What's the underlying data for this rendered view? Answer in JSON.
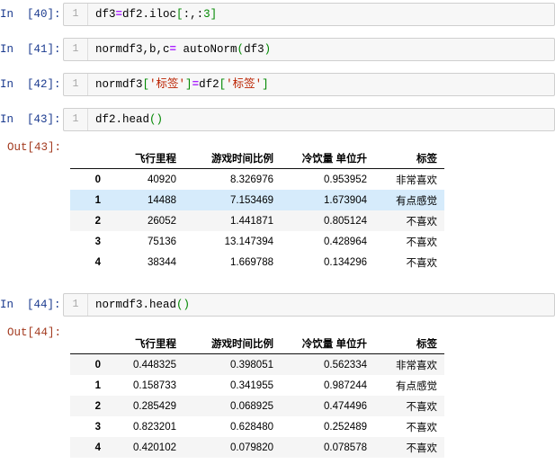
{
  "notebook": {
    "cells": [
      {
        "prompt": "In  [40]:",
        "line_number": "1",
        "code_segments": [
          {
            "text": "df3",
            "kind": "plain"
          },
          {
            "text": "=",
            "kind": "op"
          },
          {
            "text": "df2.iloc",
            "kind": "plain"
          },
          {
            "text": "[",
            "kind": "punct"
          },
          {
            "text": ":,:",
            "kind": "plain"
          },
          {
            "text": "3",
            "kind": "num"
          },
          {
            "text": "]",
            "kind": "punct"
          }
        ]
      },
      {
        "prompt": "In  [41]:",
        "line_number": "1",
        "code_segments": [
          {
            "text": "normdf3,b,c",
            "kind": "plain"
          },
          {
            "text": "=",
            "kind": "op"
          },
          {
            "text": " autoNorm",
            "kind": "plain"
          },
          {
            "text": "(",
            "kind": "punct"
          },
          {
            "text": "df3",
            "kind": "plain"
          },
          {
            "text": ")",
            "kind": "punct"
          }
        ]
      },
      {
        "prompt": "In  [42]:",
        "line_number": "1",
        "code_segments": [
          {
            "text": "normdf3",
            "kind": "plain"
          },
          {
            "text": "[",
            "kind": "punct"
          },
          {
            "text": "'标签'",
            "kind": "str"
          },
          {
            "text": "]",
            "kind": "punct"
          },
          {
            "text": "=",
            "kind": "op"
          },
          {
            "text": "df2",
            "kind": "plain"
          },
          {
            "text": "[",
            "kind": "punct"
          },
          {
            "text": "'标签'",
            "kind": "str"
          },
          {
            "text": "]",
            "kind": "punct"
          }
        ]
      },
      {
        "prompt": "In  [43]:",
        "line_number": "1",
        "code_segments": [
          {
            "text": "df2.head",
            "kind": "plain"
          },
          {
            "text": "()",
            "kind": "punct"
          }
        ]
      },
      {
        "prompt": "In  [44]:",
        "line_number": "1",
        "code_segments": [
          {
            "text": "normdf3.head",
            "kind": "plain"
          },
          {
            "text": "()",
            "kind": "punct"
          }
        ]
      }
    ],
    "outputs": [
      {
        "prompt": "Out[43]:",
        "columns": [
          "",
          "飞行里程",
          "游戏时间比例",
          "冷饮量 单位升",
          "标签"
        ],
        "rows": [
          {
            "index": "0",
            "values": [
              "40920",
              "8.326976",
              "0.953952",
              "非常喜欢"
            ],
            "style": "plain"
          },
          {
            "index": "1",
            "values": [
              "14488",
              "7.153469",
              "1.673904",
              "有点感觉"
            ],
            "style": "highlight"
          },
          {
            "index": "2",
            "values": [
              "26052",
              "1.441871",
              "0.805124",
              "不喜欢"
            ],
            "style": "stripe"
          },
          {
            "index": "3",
            "values": [
              "75136",
              "13.147394",
              "0.428964",
              "不喜欢"
            ],
            "style": "plain"
          },
          {
            "index": "4",
            "values": [
              "38344",
              "1.669788",
              "0.134296",
              "不喜欢"
            ],
            "style": "plain"
          }
        ]
      },
      {
        "prompt": "Out[44]:",
        "columns": [
          "",
          "飞行里程",
          "游戏时间比例",
          "冷饮量 单位升",
          "标签"
        ],
        "rows": [
          {
            "index": "0",
            "values": [
              "0.448325",
              "0.398051",
              "0.562334",
              "非常喜欢"
            ],
            "style": "stripe"
          },
          {
            "index": "1",
            "values": [
              "0.158733",
              "0.341955",
              "0.987244",
              "有点感觉"
            ],
            "style": "plain"
          },
          {
            "index": "2",
            "values": [
              "0.285429",
              "0.068925",
              "0.474496",
              "不喜欢"
            ],
            "style": "stripe"
          },
          {
            "index": "3",
            "values": [
              "0.823201",
              "0.628480",
              "0.252489",
              "不喜欢"
            ],
            "style": "plain"
          },
          {
            "index": "4",
            "values": [
              "0.420102",
              "0.079820",
              "0.078578",
              "不喜欢"
            ],
            "style": "stripe"
          }
        ]
      }
    ]
  },
  "colors": {
    "prompt_in": "#1a3a8f",
    "prompt_out": "#a33b20",
    "code_background": "#f7f7f7",
    "code_border": "#cfcfcf",
    "row_highlight": "#d6ebfb",
    "row_stripe": "#f5f5f5",
    "operator": "#aa22ff",
    "string": "#bb2200",
    "punctuation": "#008800"
  }
}
